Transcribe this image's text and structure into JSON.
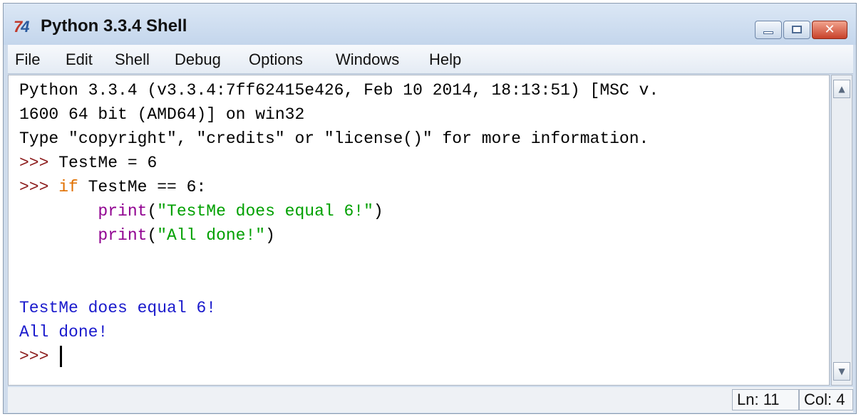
{
  "window": {
    "title": "Python 3.3.4 Shell",
    "icon": {
      "glyph": "7",
      "glyph2": "4",
      "name": "python-idle-icon"
    }
  },
  "controls": {
    "minimize": "minimize-icon",
    "maximize": "maximize-icon",
    "close_glyph": "✕"
  },
  "menu": [
    "File",
    "Edit",
    "Shell",
    "Debug",
    "Options",
    "Windows",
    "Help"
  ],
  "shell": {
    "banner_1": "Python 3.3.4 (v3.3.4:7ff62415e426, Feb 10 2014, 18:13:51) [MSC v.",
    "banner_2": "1600 64 bit (AMD64)] on win32",
    "banner_3": "Type \"copyright\", \"credits\" or \"license()\" for more information.",
    "prompt": ">>> ",
    "cmd1": "TestMe = 6",
    "kw_if": "if",
    "cmd2_rest": " TestMe == 6:",
    "indent": "        ",
    "print_fn": "print",
    "print1_open": "(",
    "print1_str": "\"TestMe does equal 6!\"",
    "print1_close": ")",
    "print2_str": "\"All done!\"",
    "out1": "TestMe does equal 6!",
    "out2": "All done!"
  },
  "status": {
    "ln": "Ln: 11",
    "col": "Col: 4"
  },
  "colors": {
    "prompt": "#8b1a1a",
    "keyword": "#e07000",
    "builtin": "#900090",
    "string": "#00a000",
    "output": "#1a1acc"
  }
}
